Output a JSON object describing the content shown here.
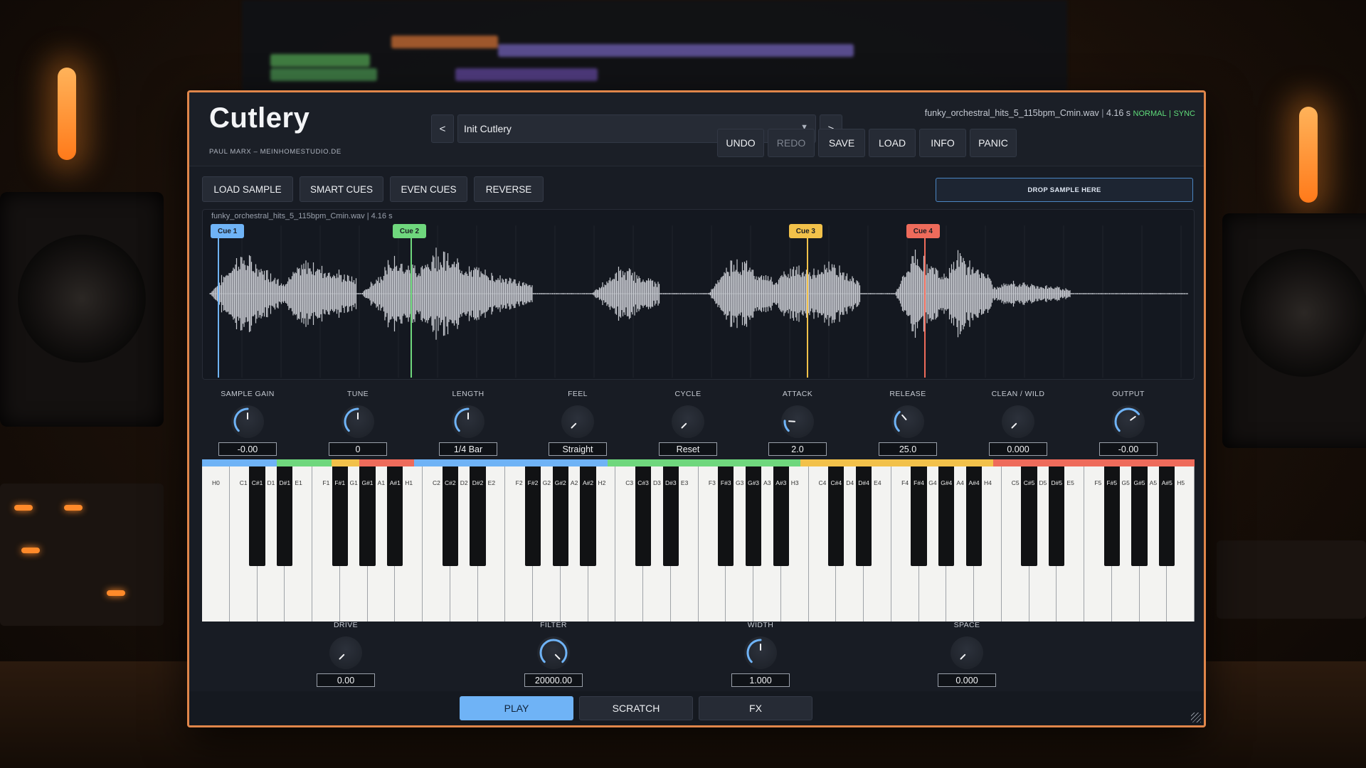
{
  "app": {
    "title": "Cutlery",
    "subtitle": "PAUL MARX  –  MEINHOMESTUDIO.DE"
  },
  "preset": {
    "prev_label": "<",
    "next_label": ">",
    "name": "Init Cutlery",
    "caret_icon": "caret-down-icon"
  },
  "file_info": {
    "filename": "funky_orchestral_hits_5_115bpm_Cmin.wav",
    "separator": "|",
    "duration": "4.16 s",
    "mode": "NORMAL",
    "mode_separator": "|",
    "sync": "SYNC"
  },
  "header_buttons": [
    "UNDO",
    "REDO",
    "SAVE",
    "LOAD",
    "INFO",
    "PANIC"
  ],
  "toolbar": {
    "buttons": [
      "LOAD SAMPLE",
      "SMART CUES",
      "EVEN CUES",
      "REVERSE"
    ],
    "drop_zone": "DROP SAMPLE HERE"
  },
  "waveform": {
    "caption": "funky_orchestral_hits_5_115bpm_Cmin.wav  |  4.16 s",
    "cues": [
      {
        "label": "Cue 1",
        "color": "#6fb3f6",
        "position": 0.008
      },
      {
        "label": "Cue 2",
        "color": "#6fd77d",
        "position": 0.205
      },
      {
        "label": "Cue 3",
        "color": "#f2c14a",
        "position": 0.61
      },
      {
        "label": "Cue 4",
        "color": "#ee6b5b",
        "position": 0.73
      }
    ]
  },
  "knobs": [
    {
      "label": "SAMPLE GAIN",
      "value": "-0.00",
      "level": 0.5
    },
    {
      "label": "TUNE",
      "value": "0",
      "level": 0.5
    },
    {
      "label": "LENGTH",
      "value": "1/4 Bar",
      "level": 0.5
    },
    {
      "label": "FEEL",
      "value": "Straight",
      "level": 0.0
    },
    {
      "label": "CYCLE",
      "value": "Reset",
      "level": 0.0
    },
    {
      "label": "ATTACK",
      "value": "2.0",
      "level": 0.18
    },
    {
      "label": "RELEASE",
      "value": "25.0",
      "level": 0.35
    },
    {
      "label": "CLEAN / WILD",
      "value": "0.000",
      "level": 0.0
    },
    {
      "label": "OUTPUT",
      "value": "-0.00",
      "level": 0.7
    }
  ],
  "keyboard": {
    "zone_colors": [
      "#6fb3f6",
      "#6fd77d",
      "#f2c14a",
      "#ee6b5b"
    ],
    "white_keys": [
      "H0",
      "C1",
      "D1",
      "E1",
      "F1",
      "G1",
      "A1",
      "H1",
      "C2",
      "D2",
      "E2",
      "F2",
      "G2",
      "A2",
      "H2",
      "C3",
      "D3",
      "E3",
      "F3",
      "G3",
      "A3",
      "H3",
      "C4",
      "D4",
      "E4",
      "F4",
      "G4",
      "A4",
      "H4",
      "C5",
      "D5",
      "E5",
      "F5",
      "G5",
      "A5",
      "H5"
    ],
    "black_keys": [
      "C#1",
      "D#1",
      "F#1",
      "G#1",
      "A#1",
      "C#2",
      "D#2",
      "F#2",
      "G#2",
      "A#2",
      "C#3",
      "D#3",
      "F#3",
      "G#3",
      "A#3",
      "C#4",
      "D#4",
      "F#4",
      "G#4",
      "A#4",
      "C#5",
      "D#5",
      "F#5",
      "G#5",
      "A#5"
    ]
  },
  "bottom_knobs": [
    {
      "label": "DRIVE",
      "value": "0.00",
      "level": 0.0
    },
    {
      "label": "FILTER",
      "value": "20000.00",
      "level": 1.0
    },
    {
      "label": "WIDTH",
      "value": "1.000",
      "level": 0.5
    },
    {
      "label": "SPACE",
      "value": "0.000",
      "level": 0.0
    }
  ],
  "tabs": [
    {
      "label": "PLAY",
      "active": true
    },
    {
      "label": "SCRATCH",
      "active": false
    },
    {
      "label": "FX",
      "active": false
    }
  ],
  "colors": {
    "accent": "#6fb3f6",
    "frame": "#e0864a",
    "mode_green": "#5fdc7a"
  }
}
